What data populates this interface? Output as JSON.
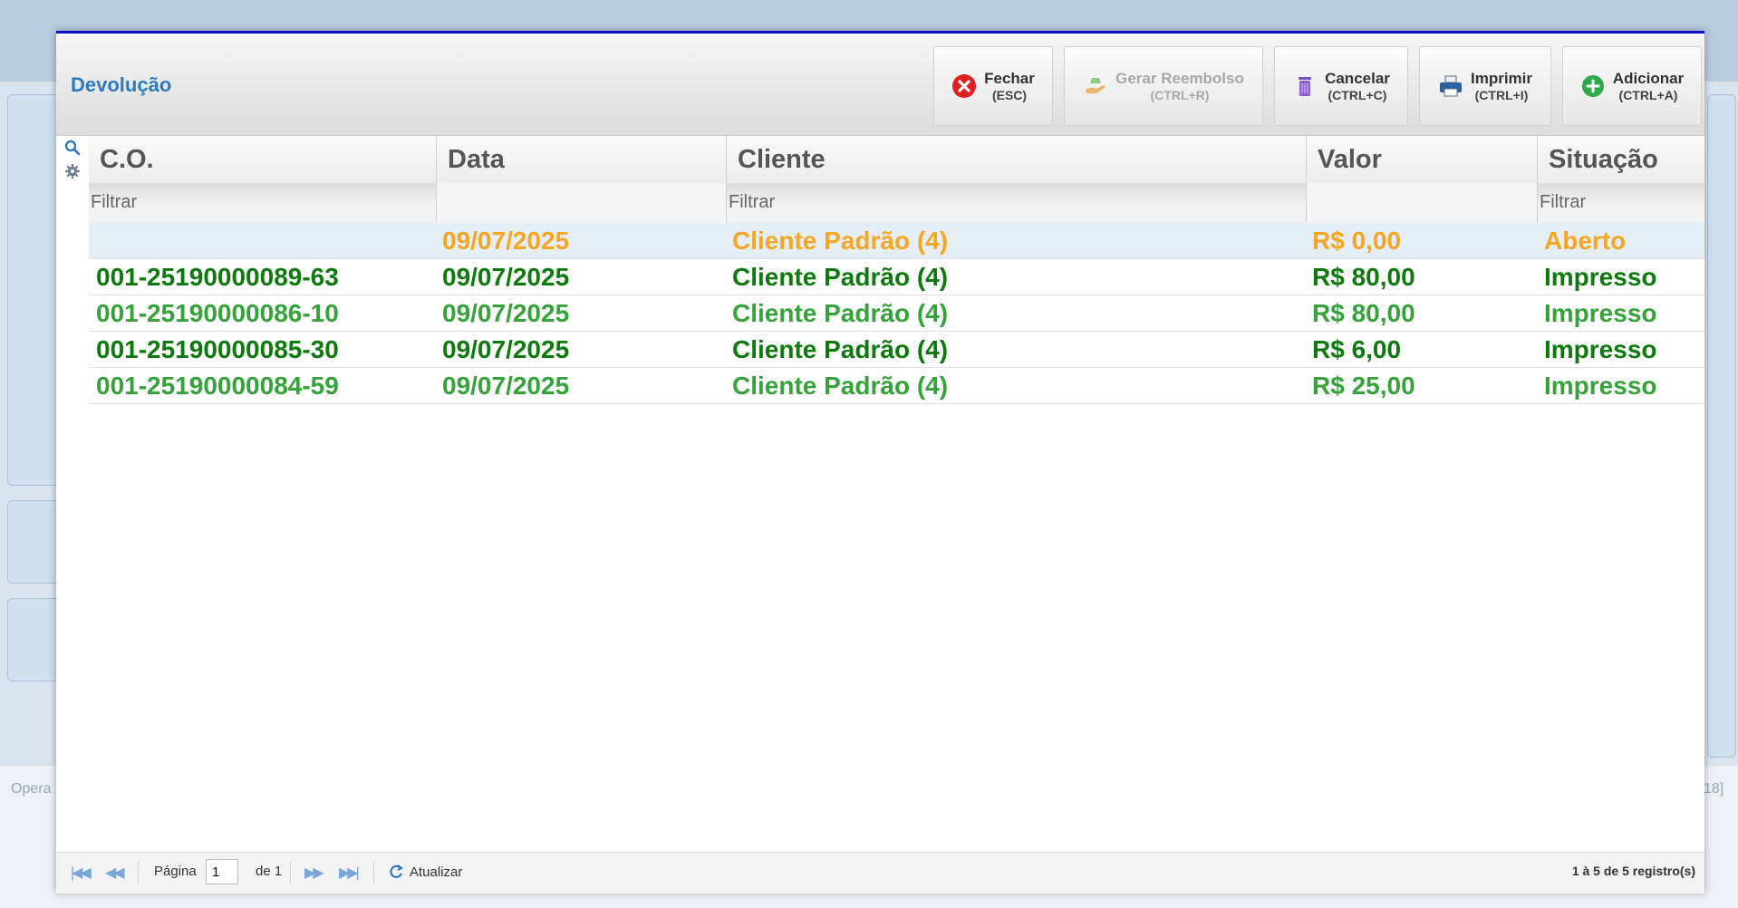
{
  "background": {
    "left_label": "Opera",
    "right_label": "18]"
  },
  "modal": {
    "title": "Devolução",
    "toolbar": {
      "close": {
        "label": "Fechar",
        "shortcut": "(ESC)"
      },
      "refund": {
        "label": "Gerar Reembolso",
        "shortcut": "(CTRL+R)",
        "disabled": true
      },
      "cancel": {
        "label": "Cancelar",
        "shortcut": "(CTRL+C)"
      },
      "print": {
        "label": "Imprimir",
        "shortcut": "(CTRL+I)"
      },
      "add": {
        "label": "Adicionar",
        "shortcut": "(CTRL+A)"
      }
    },
    "grid": {
      "columns": [
        "C.O.",
        "Data",
        "Cliente",
        "Valor",
        "Situação"
      ],
      "filters": [
        "Filtrar",
        "",
        "Filtrar",
        "",
        "Filtrar"
      ],
      "rows": [
        {
          "co": "",
          "date": "09/07/2025",
          "client": "Cliente Padrão (4)",
          "value": "R$ 0,00",
          "status": "Aberto"
        },
        {
          "co": "001-25190000089-63",
          "date": "09/07/2025",
          "client": "Cliente Padrão (4)",
          "value": "R$ 80,00",
          "status": "Impresso"
        },
        {
          "co": "001-25190000086-10",
          "date": "09/07/2025",
          "client": "Cliente Padrão (4)",
          "value": "R$ 80,00",
          "status": "Impresso"
        },
        {
          "co": "001-25190000085-30",
          "date": "09/07/2025",
          "client": "Cliente Padrão (4)",
          "value": "R$ 6,00",
          "status": "Impresso"
        },
        {
          "co": "001-25190000084-59",
          "date": "09/07/2025",
          "client": "Cliente Padrão (4)",
          "value": "R$ 25,00",
          "status": "Impresso"
        }
      ]
    },
    "pager": {
      "page_label": "Página",
      "page_value": "1",
      "of_label": "de 1",
      "refresh_label": "Atualizar",
      "summary": "1 à 5 de 5 registro(s)"
    }
  },
  "colors": {
    "title": "#2b7bc0",
    "status_open": "#f5a623",
    "status_printed_dark": "#0e7a0e",
    "status_printed_light": "#36a33a",
    "modal_top_border": "#1010c8"
  }
}
